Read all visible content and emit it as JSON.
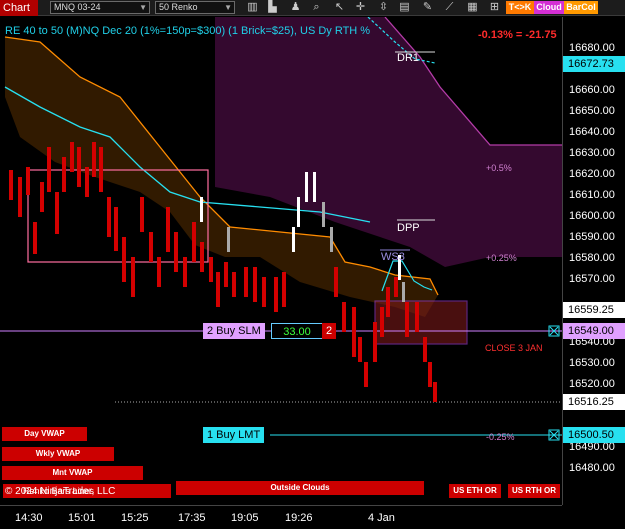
{
  "toolbar": {
    "tab_label": "Chart",
    "instrument": "MNQ 03-24",
    "bar_type": "50 Renko",
    "btn_tk": "T<>K",
    "btn_cloud": "Cloud",
    "btn_barcol": "BarCol",
    "colors": {
      "tab": "#b00000",
      "tk": "#ff7a00",
      "cloud": "#d42fd4",
      "barcol": "#ff9900"
    }
  },
  "chart": {
    "title": "RE 40 to 50 (M)NQ Dec 20 (1%=150p=$300) (1 Brick=$25), US Dy RTH %",
    "change": "-0.13% = -21.75",
    "levels": {
      "dr1": "DR1",
      "dpp": "DPP",
      "ws3": "WS3"
    },
    "pct_labels": {
      "p05": "+0.5%",
      "p025": "+0.25%",
      "m025": "-0.25%"
    },
    "close_label": "CLOSE 3 JAN",
    "orders": {
      "sell": {
        "label": "2 Buy SLM",
        "price": "33.00",
        "qty": "2"
      },
      "limit": {
        "label": "1 Buy LMT"
      }
    },
    "indicator_buttons": [
      "Day VWAP",
      "Wkly VWAP",
      "Mnt VWAP",
      "Outside Clouds",
      "US ETH OR",
      "US RTH OR"
    ],
    "copyright": "© 2024 NinjaTrader, LLC",
    "overlay_text": "Renko Bars Lines"
  },
  "axis": {
    "prices": [
      "16680.00",
      "16670.00",
      "16660.00",
      "16650.00",
      "16640.00",
      "16630.00",
      "16620.00",
      "16610.00",
      "16600.00",
      "16590.00",
      "16580.00",
      "16570.00",
      "16560.00",
      "16550.00",
      "16540.00",
      "16530.00",
      "16520.00",
      "16510.00",
      "16500.00",
      "16490.00",
      "16480.00"
    ],
    "highlights": {
      "last_top": "16672.73",
      "mid": "16559.25",
      "order": "16549.00",
      "last": "16516.25",
      "limit": "16500.50"
    }
  },
  "times": [
    "14:30",
    "15:01",
    "15:25",
    "17:35",
    "19:05",
    "19:26",
    "4 Jan"
  ]
}
